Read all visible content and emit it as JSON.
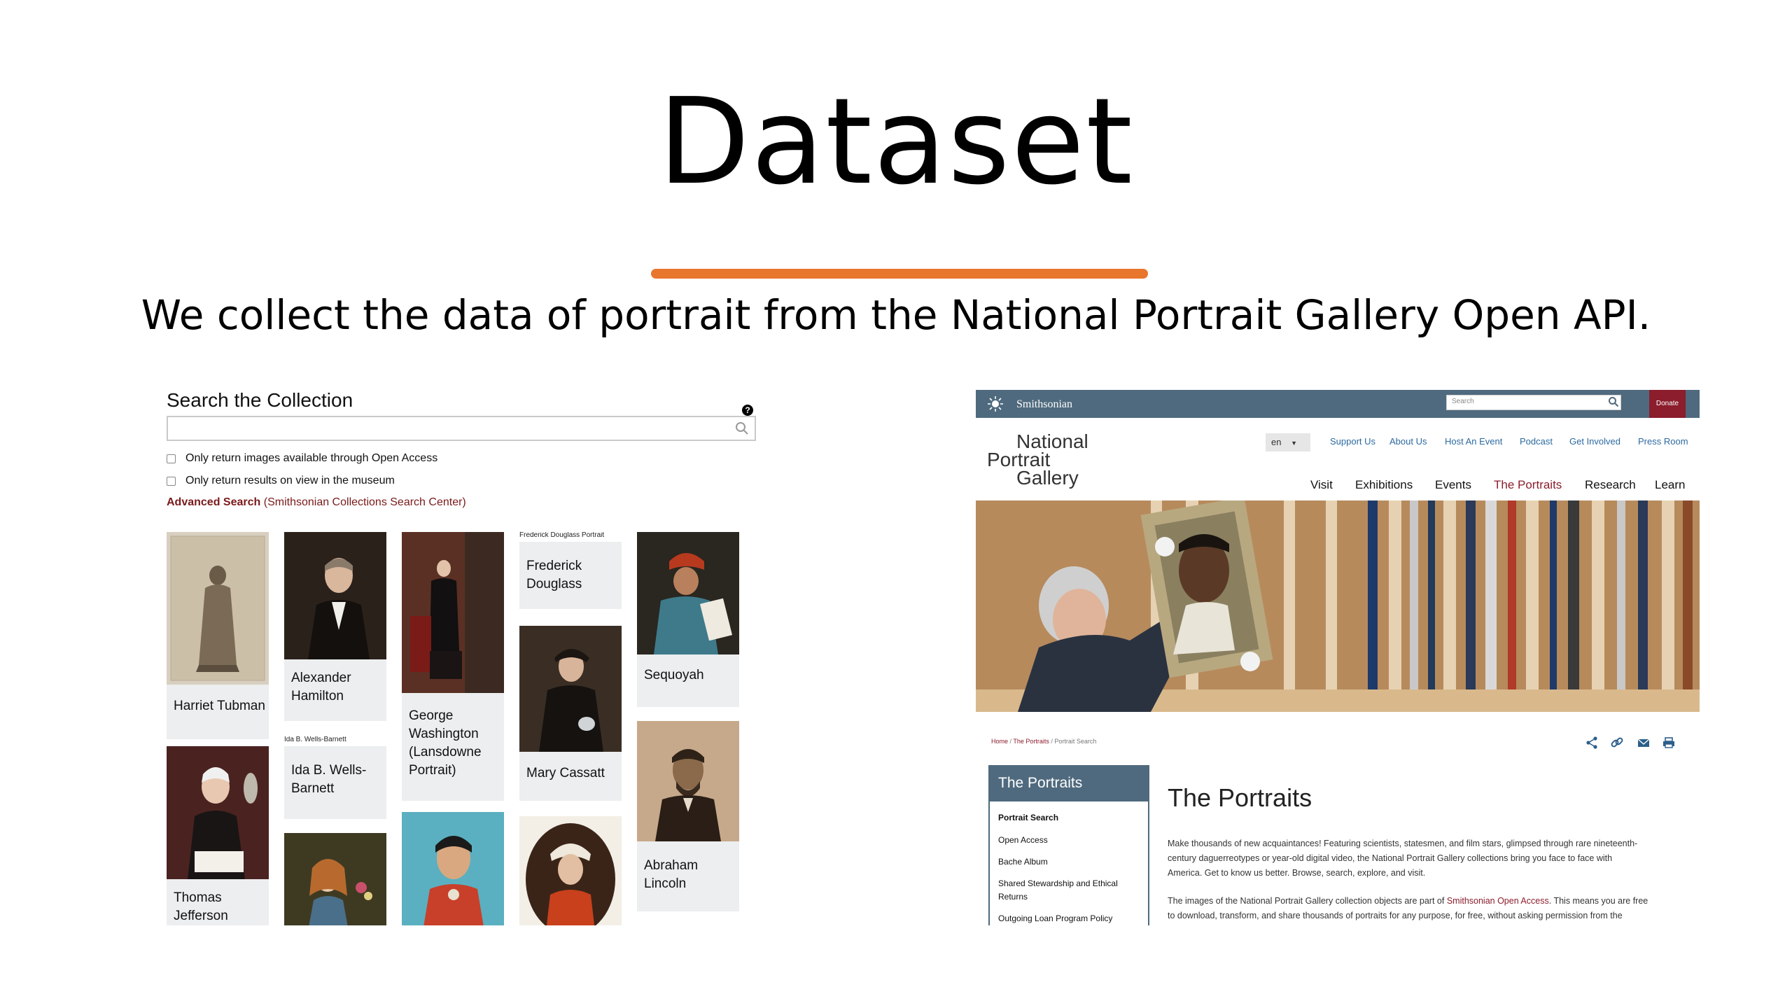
{
  "slide": {
    "title": "Dataset",
    "subtitle": "We collect the data of portrait from the National Portrait Gallery Open API.",
    "accent_color": "#e8762c"
  },
  "search_panel": {
    "heading": "Search the Collection",
    "help_icon": "question-icon",
    "search_value": "",
    "checkbox_open_access": "Only return images available through Open Access",
    "checkbox_on_view": "Only return results on view in the museum",
    "advanced_label": "Advanced Search",
    "advanced_suffix": "(Smithsonian Collections Search Center)",
    "results": [
      {
        "name": "Harriet Tubman"
      },
      {
        "name": "Alexander Hamilton"
      },
      {
        "name": "George Washington (Lansdowne Portrait)"
      },
      {
        "name": "Frederick Douglass",
        "broken_alt": "Frederick Douglass Portrait"
      },
      {
        "name": "Sequoyah"
      },
      {
        "name": "Ida B. Wells-Barnett",
        "broken_alt": "Ida B. Wells-Barnett"
      },
      {
        "name": "Mary Cassatt"
      },
      {
        "name": "Thomas Jefferson"
      },
      {
        "name": "Abraham Lincoln"
      }
    ]
  },
  "npg_site": {
    "brand": "Smithsonian",
    "search_placeholder": "Search",
    "donate": "Donate",
    "logo": [
      "National",
      "Portrait",
      "Gallery"
    ],
    "language": "en",
    "utility_nav": [
      "Support Us",
      "About Us",
      "Host An Event",
      "Podcast",
      "Get Involved",
      "Press Room"
    ],
    "main_nav": [
      "Visit",
      "Exhibitions",
      "Events",
      "The Portraits",
      "Research",
      "Learn"
    ],
    "breadcrumb": [
      "Home",
      "The Portraits",
      "Portrait Search"
    ],
    "sidebar_title": "The Portraits",
    "sidebar_items": [
      "Portrait Search",
      "Open Access",
      "Bache Album",
      "Shared Stewardship and Ethical",
      "Returns",
      "Outgoing Loan Program Policy"
    ],
    "page_title": "The Portraits",
    "para1_lines": [
      "Make thousands of new acquaintances! Featuring scientists, statesmen, and film stars, glimpsed through rare nineteenth-",
      "century daguerreotypes or year-old digital video, the National Portrait Gallery collections bring you face to face with",
      "America. Get to know us better. Browse, search, explore, and visit."
    ],
    "para2_pre": "The images of the National Portrait Gallery collection objects are part of ",
    "para2_link": "Smithsonian Open Access",
    "para2_post": ". This means you are free",
    "para2_line2": "to download, transform, and share thousands of portraits for any purpose, for free, without asking permission from the",
    "brand_color": "#4f6a7e",
    "accent_red": "#8b1d2c"
  }
}
